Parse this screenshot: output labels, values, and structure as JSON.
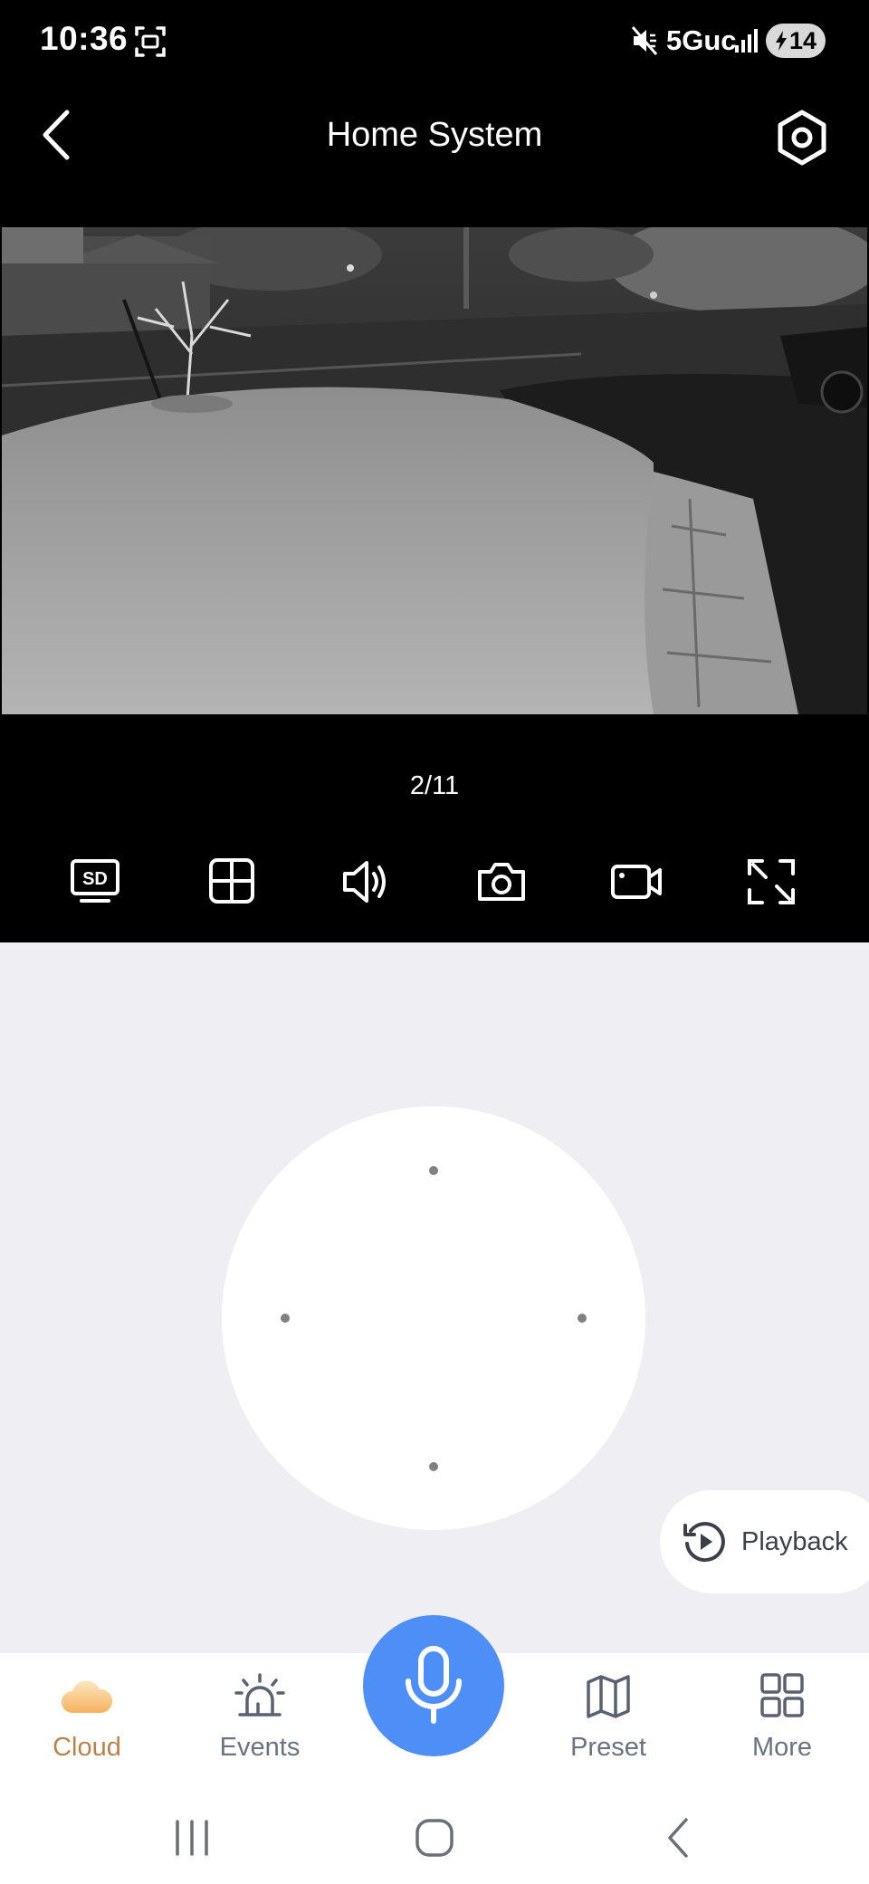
{
  "status_bar": {
    "time": "10:36",
    "network": "5Guc",
    "battery": "14"
  },
  "header": {
    "title": "Home System"
  },
  "camera": {
    "page_indicator": "2/11"
  },
  "controls": {
    "sd_label": "SD",
    "icons": [
      "sd-quality-icon",
      "grid-icon",
      "speaker-icon",
      "camera-icon",
      "video-record-icon",
      "fullscreen-icon"
    ]
  },
  "playback": {
    "label": "Playback"
  },
  "bottom_nav": {
    "cloud": "Cloud",
    "events": "Events",
    "preset": "Preset",
    "more": "More"
  },
  "colors": {
    "accent_blue": "#4e8ef7",
    "cloud_active": "#f6b35e",
    "cloud_label": "#b8834c"
  }
}
